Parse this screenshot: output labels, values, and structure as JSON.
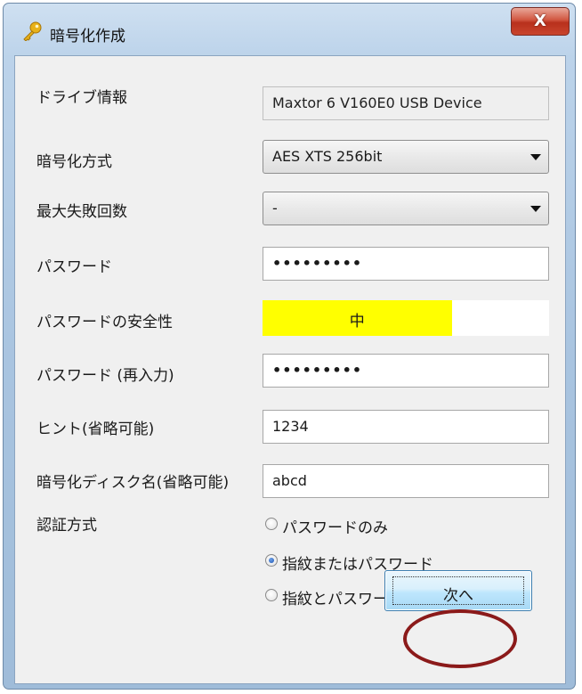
{
  "window": {
    "title": "暗号化作成",
    "close_label": "X",
    "icon": "key-icon"
  },
  "form": {
    "drive_info": {
      "label": "ドライブ情報",
      "value": "Maxtor 6 V160E0 USB Device"
    },
    "encryption_method": {
      "label": "暗号化方式",
      "value": "AES XTS 256bit"
    },
    "max_failures": {
      "label": "最大失敗回数",
      "value": "-"
    },
    "password": {
      "label": "パスワード",
      "value": "•••••••••"
    },
    "password_strength": {
      "label": "パスワードの安全性",
      "value": "中",
      "level": 0.66,
      "color": "#ffff00"
    },
    "password_confirm": {
      "label": "パスワード (再入力)",
      "value": "•••••••••"
    },
    "hint": {
      "label": "ヒント(省略可能)",
      "value": "1234"
    },
    "disk_name": {
      "label": "暗号化ディスク名(省略可能)",
      "value": "abcd"
    },
    "auth_method": {
      "label": "認証方式",
      "options": [
        {
          "label": "パスワードのみ",
          "checked": false
        },
        {
          "label": "指紋またはパスワード",
          "checked": true
        },
        {
          "label": "指紋とパスワードの両方",
          "checked": false
        }
      ]
    }
  },
  "buttons": {
    "next_label": "次へ"
  },
  "colors": {
    "annotation": "#8b1a1a",
    "close_button": "#c9452d"
  }
}
